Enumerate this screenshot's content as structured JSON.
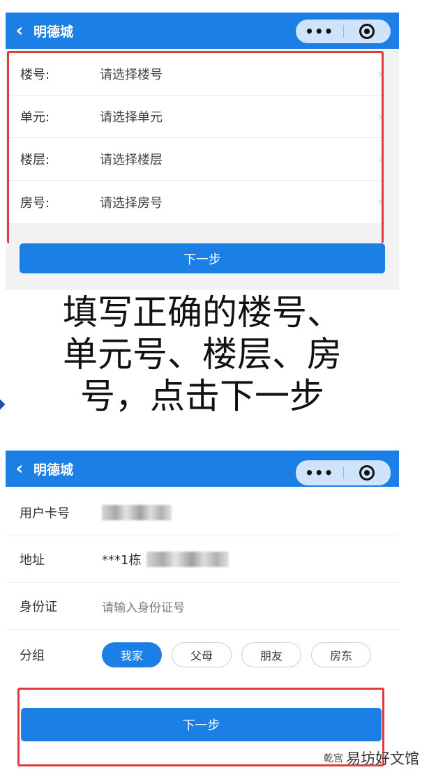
{
  "panel1": {
    "nav": {
      "title": "明德城",
      "back_icon": "chevron-left-icon",
      "more_icon": "more-dots-icon",
      "close_icon": "target-icon"
    },
    "rows": [
      {
        "label": "楼号:",
        "value": "请选择楼号"
      },
      {
        "label": "单元:",
        "value": "请选择单元"
      },
      {
        "label": "楼层:",
        "value": "请选择楼层"
      },
      {
        "label": "房号:",
        "value": "请选择房号"
      }
    ],
    "next_label": "下一步"
  },
  "caption": {
    "line1": "填写正确的楼号、",
    "line2": "单元号、楼层、房",
    "line3": "号，点击下一步"
  },
  "panel2": {
    "nav": {
      "title": "明德城"
    },
    "rows": {
      "card": {
        "label": "用户卡号"
      },
      "address": {
        "label": "地址",
        "prefix": "***1栋"
      },
      "id": {
        "label": "身份证",
        "placeholder": "请输入身份证号"
      },
      "group": {
        "label": "分组",
        "options": [
          "我家",
          "父母",
          "朋友",
          "房东"
        ],
        "selected": "我家"
      }
    },
    "next_label": "下一步"
  },
  "watermark": {
    "small": "乾宫",
    "main": "易坊好文馆"
  },
  "colors": {
    "primary": "#1b7fe6",
    "highlight": "#e03a3a",
    "background": "#f1f2f4"
  }
}
